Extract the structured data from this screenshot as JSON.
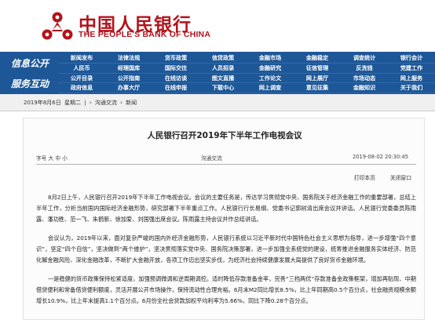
{
  "brand": {
    "name_cn": "中国人民银行",
    "name_en": "THE PEOPLE'S BANK OF CHINA",
    "color": "#b3131b"
  },
  "nav": {
    "bg_color": "#1d5797",
    "section1": "信息公开",
    "section2": "服务互动",
    "rows": [
      [
        "新闻发布",
        "法律法规",
        "货币政策",
        "信贷政策",
        "金融市场",
        "金融稳定",
        "调查统计",
        "银行会计",
        "支付体系",
        "金融科技"
      ],
      [
        "人民币",
        "经理国库",
        "国际交往",
        "人员招录",
        "金融研究",
        "征信管理",
        "反洗钱",
        "党建工作",
        "工会工作",
        "金融标准化"
      ],
      [
        "公开目录",
        "公开指南",
        "在线访谈",
        "图文直播",
        "工作论文",
        "网上展厅",
        "市场动态",
        "网上服务",
        "报告下载",
        "报刊年鉴"
      ],
      [
        "政府信息",
        "办事大厅",
        "在线申报",
        "下载中心",
        "网上调查",
        "意见征集",
        "金融知识",
        "关于我们",
        "",
        ""
      ]
    ]
  },
  "breadcrumb": {
    "date": "2019年8月6日",
    "weekday": "星期二",
    "sep": "|",
    "arrow1": "›",
    "item1": "沟通交流",
    "arrow2": "›",
    "item2": "新闻"
  },
  "article": {
    "title": "人民银行召开2019年下半年工作电视会议",
    "font_size_label": "字号 大 中 小",
    "source": "沟通交流",
    "datetime": "2019-08-02 20:30:45",
    "print_label": "打印本页",
    "close_label": "关闭窗口",
    "paragraphs": [
      "8月2日上午，人民银行召开2019年下半年工作电视会议。会议的主要任务是，传达学习贯彻党中央、国务院关于经济金融工作的重要部署，总结上半年工作，分析当前国内国际经济金融形势，研究部署下半年重点工作。人民银行行长易纲、党委书记郭树清出席会议并讲话。人民银行党委委员陈雨露、潘功胜、范一飞、朱鹤新、徐加爱、刘国强出席会议。陈雨露主持会议并作总结讲话。",
      "会议认为，2019年以来，面对复杂严峻的国内外经济金融形势，人民银行系统以习近平新时代中国特色社会主义思想为指导，进一步增强“四个意识”，坚定“四个自信”，坚决做到“两个维护”，坚决贯彻落实党中央、国务院决策部署，进一步加强全系统党的建设，统筹推进金融服务实体经济、防范化解金融风险、深化金融改革，不断扩大金融开放，各项工作迈出坚实步伐，为经济社会持续健康发展大局提供了良好货币金融环境。",
      "一是稳健的货币政策保持松紧适度，加强预调微调和逆周期调控。适时降低存款准备金率，完善“三档两优”存款准备金政策框架，增加再贴现、中期借贷便利和常备借贷便利额度，灵活开展公开市场操作，保持流动性合理充裕。6月末M2同比增长8.5%，比上年同期高0.5个百分点，社会融资规模余额增长10.9%，比上年末提高1.1个百分点。6月份全社会贷款加权平均利率为5.66%，同比下降0.28个百分点。"
    ]
  }
}
